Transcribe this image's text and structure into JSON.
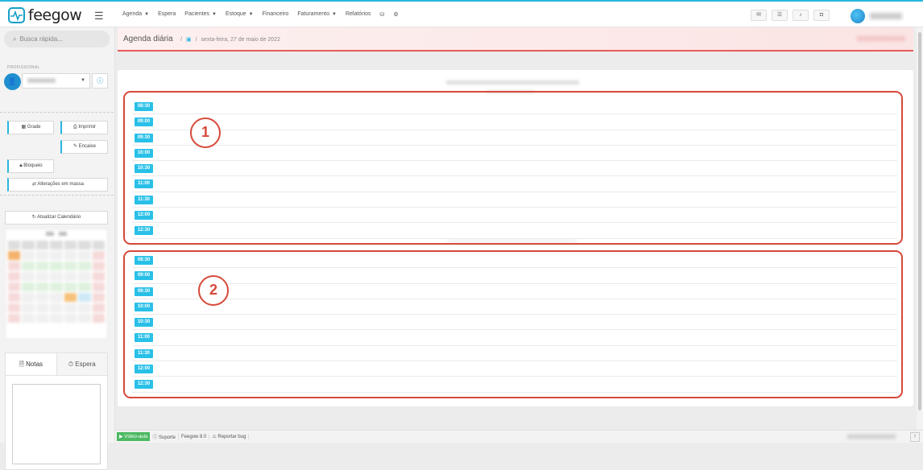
{
  "app": {
    "brand": "feegow"
  },
  "nav": {
    "items": [
      {
        "label": "Agenda",
        "caret": true
      },
      {
        "label": "Espera",
        "caret": false
      },
      {
        "label": "Pacientes",
        "caret": true
      },
      {
        "label": "Estoque",
        "caret": true
      },
      {
        "label": "Financeiro",
        "caret": false
      },
      {
        "label": "Faturamento",
        "caret": true
      },
      {
        "label": "Relatórios",
        "caret": false
      }
    ]
  },
  "sidebar": {
    "search_placeholder": "Busca rápida...",
    "professional_label": "PROFISSIONAL",
    "buttons": {
      "grade": "Grade",
      "imprimir": "Imprimir",
      "encaixe": "Encaixe",
      "bloqueio": "Bloqueio",
      "alteracoes": "Alterações em massa",
      "atualizar": "Atualizar Calendário"
    },
    "notes_tabs": {
      "notas": "Notas",
      "espera": "Espera"
    }
  },
  "header": {
    "title": "Agenda diária",
    "date": "sexta-feira, 27 de maio de 2022"
  },
  "schedules": [
    {
      "annotation": "1",
      "times": [
        "08:30",
        "09:00",
        "09:30",
        "10:00",
        "10:30",
        "11:00",
        "11:30",
        "12:00",
        "12:30"
      ]
    },
    {
      "annotation": "2",
      "times": [
        "08:30",
        "09:00",
        "09:30",
        "10:00",
        "10:30",
        "11:00",
        "11:30",
        "12:00",
        "12:30"
      ]
    }
  ],
  "footer": {
    "video": "Vídeo-aula",
    "suporte": "Suporte",
    "version": "Feegow 8.0",
    "bug": "Reportar bug"
  },
  "colors": {
    "accent": "#29c0e8",
    "annotation": "#d7493a",
    "header_border": "#e75a5a"
  }
}
